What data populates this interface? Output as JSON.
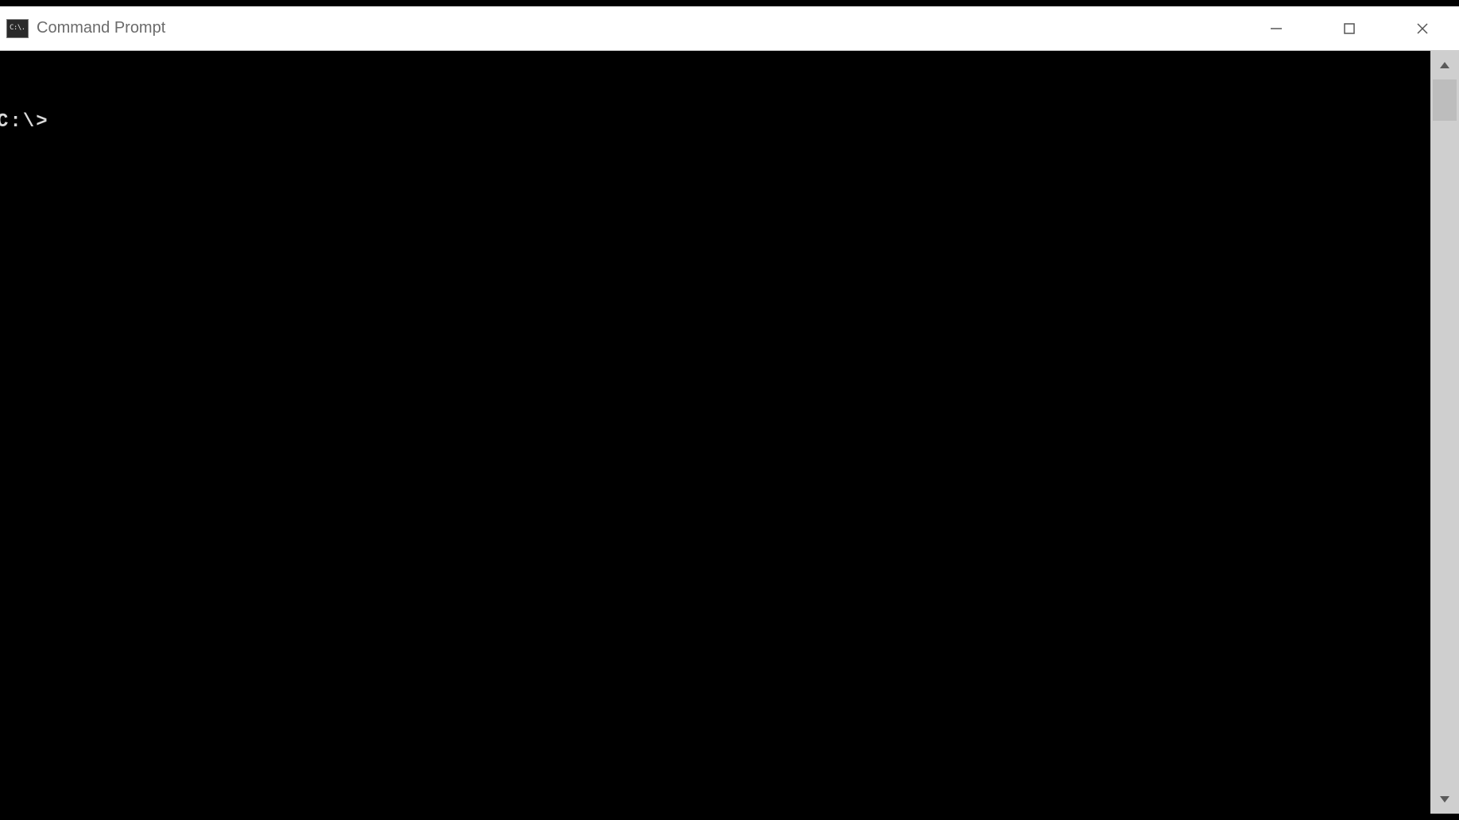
{
  "window": {
    "title": "Command Prompt",
    "icon_glyph": "C:\\."
  },
  "terminal": {
    "prompt": "C:\\>"
  }
}
